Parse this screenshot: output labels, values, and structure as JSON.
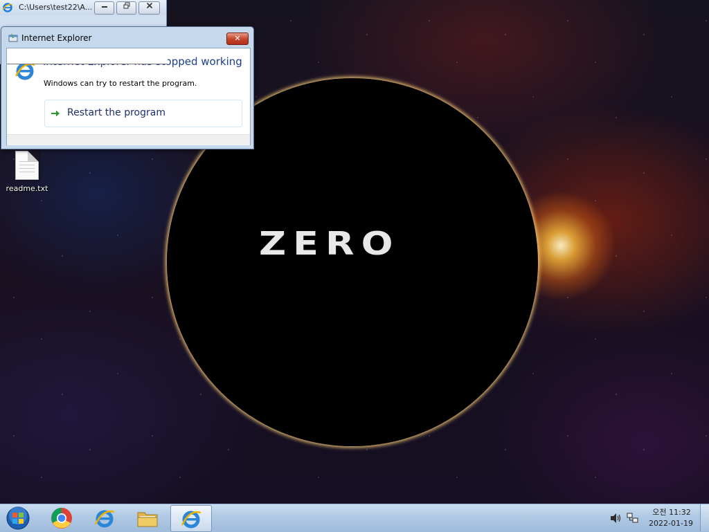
{
  "desktop": {
    "wallpaper_logo": "ZERO",
    "icons": [
      {
        "label": "readme.txt",
        "icon": "text-file-icon"
      }
    ]
  },
  "background_window": {
    "title": "C:\\Users\\test22\\A...",
    "icon": "internet-explorer-icon",
    "controls": [
      "minimize",
      "restore",
      "close"
    ]
  },
  "dialog": {
    "title": "Internet Explorer",
    "heading": "Internet Explorer has stopped working",
    "message": "Windows can try to restart the program.",
    "command": "Restart the program",
    "close_glyph": "✕"
  },
  "taskbar": {
    "start_icon": "windows-start-orb-icon",
    "pinned": [
      {
        "name": "chrome",
        "icon": "chrome-icon"
      },
      {
        "name": "internet-explorer",
        "icon": "internet-explorer-icon"
      },
      {
        "name": "file-explorer",
        "icon": "folder-icon"
      },
      {
        "name": "internet-explorer-running",
        "icon": "internet-explorer-icon",
        "active": true
      }
    ],
    "tray": {
      "icons": [
        "speaker-icon",
        "network-icon"
      ],
      "time": "오전 11:32",
      "date": "2022-01-19"
    }
  },
  "colors": {
    "dialog_heading": "#1e3d8f",
    "close_button": "#c4412a",
    "taskbar": "#b0c9e4",
    "corona": "#ff9a20"
  }
}
